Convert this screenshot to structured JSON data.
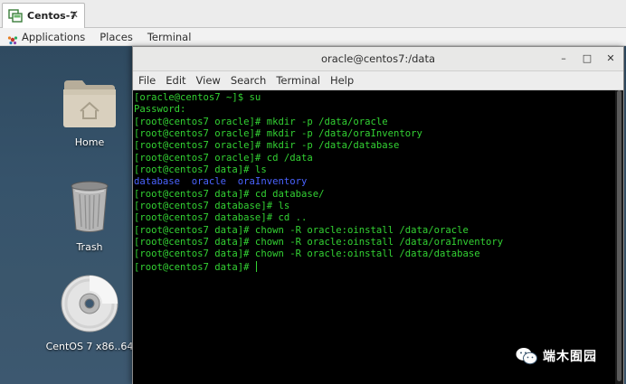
{
  "vm_tab": {
    "title": "Centos-7",
    "close": "✕"
  },
  "topbar": {
    "applications": "Applications",
    "places": "Places",
    "terminal": "Terminal"
  },
  "desktop_icons": {
    "home": "Home",
    "trash": "Trash",
    "disc": "CentOS 7 x86..64"
  },
  "terminal": {
    "title": "oracle@centos7:/data",
    "controls": {
      "minimize": "–",
      "maximize": "□",
      "close": "✕"
    },
    "menu": [
      "File",
      "Edit",
      "View",
      "Search",
      "Terminal",
      "Help"
    ],
    "lines": [
      "[oracle@centos7 ~]$ su",
      "Password:",
      "[root@centos7 oracle]# mkdir -p /data/oracle",
      "[root@centos7 oracle]# mkdir -p /data/oraInventory",
      "[root@centos7 oracle]# mkdir -p /data/database",
      "[root@centos7 oracle]# cd /data",
      "[root@centos7 data]# ls",
      "database  oracle  oraInventory",
      "[root@centos7 data]# cd database/",
      "[root@centos7 database]# ls",
      "[root@centos7 database]# cd ..",
      "[root@centos7 data]# chown -R oracle:oinstall /data/oracle",
      "[root@centos7 data]# chown -R oracle:oinstall /data/oraInventory",
      "[root@centos7 data]# chown -R oracle:oinstall /data/database",
      "[root@centos7 data]# "
    ]
  },
  "watermark": {
    "text": "端木囿园"
  },
  "colors": {
    "terminal_text": "#33d233",
    "ls_directory": "#4a63ff",
    "terminal_bg": "#000000",
    "desktop_bg": "#36536b"
  }
}
